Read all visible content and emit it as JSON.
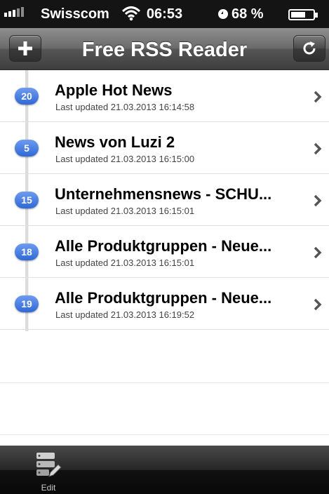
{
  "status_bar": {
    "carrier": "Swisscom",
    "time": "06:53",
    "battery_percent": "68 %",
    "battery_level": 0.68,
    "icons": [
      "signal-icon",
      "wifi-icon",
      "orientation-lock-icon",
      "battery-icon"
    ]
  },
  "nav": {
    "title": "Free RSS Reader",
    "add_icon": "plus-icon",
    "refresh_icon": "refresh-icon"
  },
  "feeds": [
    {
      "count": "20",
      "title": "Apple Hot News",
      "updated": "Last updated 21.03.2013 16:14:58"
    },
    {
      "count": "5",
      "title": "News von Luzi 2",
      "updated": "Last updated 21.03.2013 16:15:00"
    },
    {
      "count": "15",
      "title": "Unternehmensnews - SCHU...",
      "updated": "Last updated 21.03.2013 16:15:01"
    },
    {
      "count": "18",
      "title": "Alle Produktgruppen - Neue...",
      "updated": "Last updated 21.03.2013 16:15:01"
    },
    {
      "count": "19",
      "title": "Alle Produktgruppen - Neue...",
      "updated": "Last updated 21.03.2013 16:19:52"
    }
  ],
  "tab_bar": {
    "edit_label": "Edit",
    "edit_icon": "edit-list-icon"
  },
  "colors": {
    "badge": "#2f68d6",
    "nav_bar": "#555555",
    "tab_bar": "#111111"
  }
}
